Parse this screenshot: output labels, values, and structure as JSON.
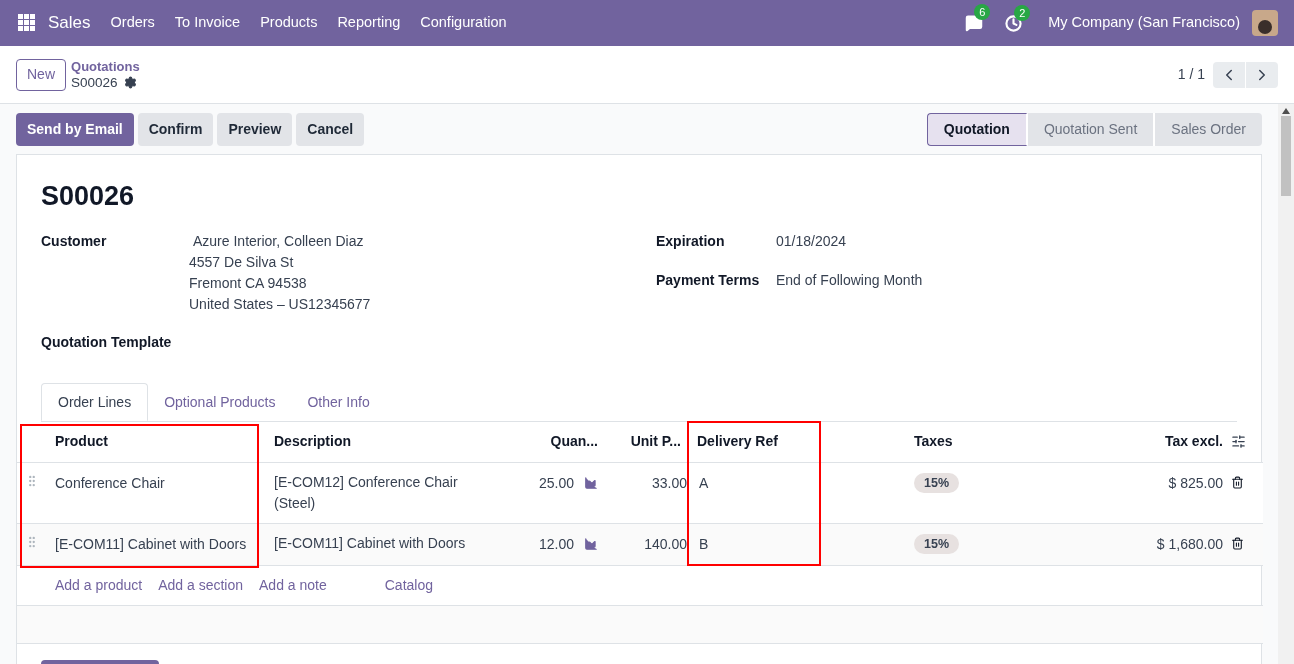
{
  "navbar": {
    "app_name": "Sales",
    "menu": [
      "Orders",
      "To Invoice",
      "Products",
      "Reporting",
      "Configuration"
    ],
    "messages_count": "6",
    "activities_count": "2",
    "company": "My Company (San Francisco)"
  },
  "control_panel": {
    "new_button": "New",
    "breadcrumb_parent": "Quotations",
    "record_name": "S00026",
    "pager": "1 / 1"
  },
  "action_buttons": [
    {
      "label": "Send by Email",
      "primary": true
    },
    {
      "label": "Confirm",
      "primary": false
    },
    {
      "label": "Preview",
      "primary": false
    },
    {
      "label": "Cancel",
      "primary": false
    }
  ],
  "status_bar": [
    {
      "label": "Quotation",
      "selected": true
    },
    {
      "label": "Quotation Sent",
      "selected": false
    },
    {
      "label": "Sales Order",
      "selected": false
    }
  ],
  "form": {
    "title": "S00026",
    "customer": {
      "label": "Customer",
      "name": "Azure Interior, Colleen Diaz",
      "address": [
        "4557 De Silva St",
        "Fremont CA 94538",
        "United States – US12345677"
      ]
    },
    "right_fields": [
      {
        "label": "Expiration",
        "value": "01/18/2024"
      },
      {
        "label": "Payment Terms",
        "value": "End of Following Month"
      }
    ],
    "template_label": "Quotation Template"
  },
  "tabs": [
    {
      "label": "Order Lines",
      "selected": true
    },
    {
      "label": "Optional Products",
      "selected": false
    },
    {
      "label": "Other Info",
      "selected": false
    }
  ],
  "table": {
    "columns": [
      "Product",
      "Description",
      "Quan...",
      "Unit P...",
      "Delivery Ref",
      "Taxes",
      "Tax excl."
    ],
    "rows": [
      {
        "product": "Conference Chair",
        "description": "[E-COM12] Conference Chair (Steel)",
        "quantity": "25.00",
        "unit_price": "33.00",
        "delivery_ref": "A",
        "taxes": "15%",
        "subtotal": "$ 825.00"
      },
      {
        "product": "[E-COM11] Cabinet with Doors",
        "description": "[E-COM11] Cabinet with Doors",
        "quantity": "12.00",
        "unit_price": "140.00",
        "delivery_ref": "B",
        "taxes": "15%",
        "subtotal": "$ 1,680.00"
      }
    ],
    "add_links": [
      "Add a product",
      "Add a section",
      "Add a note",
      "Catalog"
    ]
  }
}
